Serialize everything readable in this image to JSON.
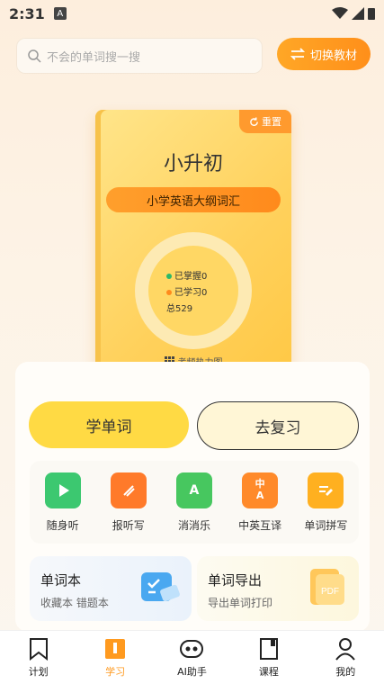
{
  "status": {
    "time": "2:31",
    "notify_letter": "A"
  },
  "search": {
    "placeholder": "不会的单词搜一搜"
  },
  "switch_button": {
    "label": "切换教材"
  },
  "book": {
    "reset_label": "重置",
    "title": "小升初",
    "subtitle": "小学英语大纲词汇",
    "mastered": "已掌握0",
    "learned": "已学习0",
    "total": "总529",
    "heatmap_label": "考频热力图"
  },
  "actions": {
    "learn": "学单词",
    "review": "去复习"
  },
  "tools": [
    {
      "label": "随身听",
      "icon": "play-icon",
      "color": "#3cc870"
    },
    {
      "label": "报听写",
      "icon": "dictation-icon",
      "color": "#ff7a2a"
    },
    {
      "label": "消消乐",
      "icon": "match-game-icon",
      "color": "#47c75f"
    },
    {
      "label": "中英互译",
      "icon": "translate-icon",
      "color": "#ff8a2a"
    },
    {
      "label": "单词拼写",
      "icon": "spell-icon",
      "color": "#ffb020"
    }
  ],
  "cards": {
    "wordbook": {
      "title": "单词本",
      "subtitle": "收藏本 错题本"
    },
    "export": {
      "title": "单词导出",
      "subtitle": "导出单词打印",
      "badge": "PDF"
    }
  },
  "tabbar": [
    {
      "label": "计划",
      "icon": "bookmark-icon",
      "active": false
    },
    {
      "label": "学习",
      "icon": "study-book-icon",
      "active": true
    },
    {
      "label": "AI助手",
      "icon": "robot-icon",
      "active": false
    },
    {
      "label": "课程",
      "icon": "course-book-icon",
      "active": false
    },
    {
      "label": "我的",
      "icon": "user-icon",
      "active": false
    }
  ],
  "colors": {
    "accent": "#ff9a1f",
    "primary_button": "#ffda44",
    "mastered_dot": "#2cb868",
    "learned_dot": "#ff8a1c"
  },
  "tool_glyphs": {
    "translate_top": "中",
    "translate_bottom": "A",
    "match": "A"
  }
}
